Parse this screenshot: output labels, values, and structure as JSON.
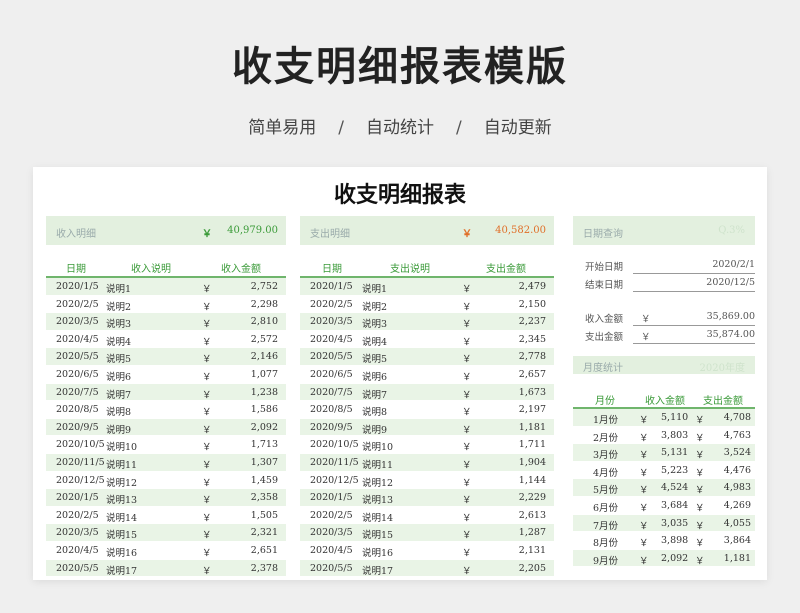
{
  "hero": {
    "title": "收支明细报表模版",
    "subtitles": [
      "简单易用",
      "自动统计",
      "自动更新"
    ],
    "separator": "/"
  },
  "sheet": {
    "title": "收支明细报表",
    "currency": "￥",
    "income": {
      "summary_label": "收入明细",
      "total": "40,979.00",
      "headers": [
        "日期",
        "收入说明",
        "收入金额"
      ],
      "rows": [
        {
          "date": "2020/1/5",
          "desc": "说明1",
          "amount": "2,752"
        },
        {
          "date": "2020/2/5",
          "desc": "说明2",
          "amount": "2,298"
        },
        {
          "date": "2020/3/5",
          "desc": "说明3",
          "amount": "2,810"
        },
        {
          "date": "2020/4/5",
          "desc": "说明4",
          "amount": "2,572"
        },
        {
          "date": "2020/5/5",
          "desc": "说明5",
          "amount": "2,146"
        },
        {
          "date": "2020/6/5",
          "desc": "说明6",
          "amount": "1,077"
        },
        {
          "date": "2020/7/5",
          "desc": "说明7",
          "amount": "1,238"
        },
        {
          "date": "2020/8/5",
          "desc": "说明8",
          "amount": "1,586"
        },
        {
          "date": "2020/9/5",
          "desc": "说明9",
          "amount": "2,092"
        },
        {
          "date": "2020/10/5",
          "desc": "说明10",
          "amount": "1,713"
        },
        {
          "date": "2020/11/5",
          "desc": "说明11",
          "amount": "1,307"
        },
        {
          "date": "2020/12/5",
          "desc": "说明12",
          "amount": "1,459"
        },
        {
          "date": "2020/1/5",
          "desc": "说明13",
          "amount": "2,358"
        },
        {
          "date": "2020/2/5",
          "desc": "说明14",
          "amount": "1,505"
        },
        {
          "date": "2020/3/5",
          "desc": "说明15",
          "amount": "2,321"
        },
        {
          "date": "2020/4/5",
          "desc": "说明16",
          "amount": "2,651"
        },
        {
          "date": "2020/5/5",
          "desc": "说明17",
          "amount": "2,378"
        }
      ]
    },
    "expense": {
      "summary_label": "支出明细",
      "total": "40,582.00",
      "headers": [
        "日期",
        "支出说明",
        "支出金额"
      ],
      "rows": [
        {
          "date": "2020/1/5",
          "desc": "说明1",
          "amount": "2,479"
        },
        {
          "date": "2020/2/5",
          "desc": "说明2",
          "amount": "2,150"
        },
        {
          "date": "2020/3/5",
          "desc": "说明3",
          "amount": "2,237"
        },
        {
          "date": "2020/4/5",
          "desc": "说明4",
          "amount": "2,345"
        },
        {
          "date": "2020/5/5",
          "desc": "说明5",
          "amount": "2,778"
        },
        {
          "date": "2020/6/5",
          "desc": "说明6",
          "amount": "2,657"
        },
        {
          "date": "2020/7/5",
          "desc": "说明7",
          "amount": "1,673"
        },
        {
          "date": "2020/8/5",
          "desc": "说明8",
          "amount": "2,197"
        },
        {
          "date": "2020/9/5",
          "desc": "说明9",
          "amount": "1,181"
        },
        {
          "date": "2020/10/5",
          "desc": "说明10",
          "amount": "1,711"
        },
        {
          "date": "2020/11/5",
          "desc": "说明11",
          "amount": "1,904"
        },
        {
          "date": "2020/12/5",
          "desc": "说明12",
          "amount": "1,144"
        },
        {
          "date": "2020/1/5",
          "desc": "说明13",
          "amount": "2,229"
        },
        {
          "date": "2020/2/5",
          "desc": "说明14",
          "amount": "2,613"
        },
        {
          "date": "2020/3/5",
          "desc": "说明15",
          "amount": "1,287"
        },
        {
          "date": "2020/4/5",
          "desc": "说明16",
          "amount": "2,131"
        },
        {
          "date": "2020/5/5",
          "desc": "说明17",
          "amount": "2,205"
        }
      ]
    },
    "query": {
      "summary_label": "日期查询",
      "ghost_text": "Q.3%",
      "start_label": "开始日期",
      "start_value": "2020/2/1",
      "end_label": "结束日期",
      "end_value": "2020/12/5",
      "income_label": "收入金额",
      "income_value": "35,869.00",
      "expense_label": "支出金额",
      "expense_value": "35,874.00"
    },
    "monthly": {
      "summary_label": "月度统计",
      "ghost_text": "2020年度",
      "headers": [
        "月份",
        "收入金额",
        "支出金额"
      ],
      "rows": [
        {
          "month": "1月份",
          "income": "5,110",
          "expense": "4,708"
        },
        {
          "month": "2月份",
          "income": "3,803",
          "expense": "4,763"
        },
        {
          "month": "3月份",
          "income": "5,131",
          "expense": "3,524"
        },
        {
          "month": "4月份",
          "income": "5,223",
          "expense": "4,476"
        },
        {
          "month": "5月份",
          "income": "4,524",
          "expense": "4,983"
        },
        {
          "month": "6月份",
          "income": "3,684",
          "expense": "4,269"
        },
        {
          "month": "7月份",
          "income": "3,035",
          "expense": "4,055"
        },
        {
          "month": "8月份",
          "income": "3,898",
          "expense": "3,864"
        },
        {
          "month": "9月份",
          "income": "2,092",
          "expense": "1,181"
        }
      ]
    }
  }
}
